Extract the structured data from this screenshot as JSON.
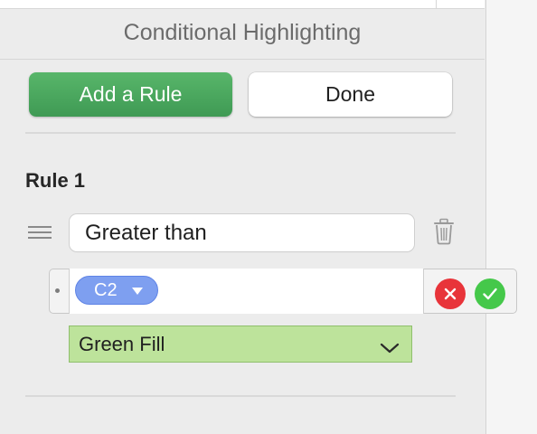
{
  "panel": {
    "title": "Conditional Highlighting"
  },
  "toolbar": {
    "add_rule_label": "Add a Rule",
    "done_label": "Done"
  },
  "rule": {
    "heading": "Rule 1",
    "condition_value": "Greater than",
    "formula_token": "C2",
    "style_value": "Green Fill"
  },
  "icons": {
    "drag_handle": "drag-handle-icon",
    "trash": "trash-icon",
    "token_menu": "triangle-down-icon",
    "cancel": "close-icon",
    "confirm": "checkmark-icon",
    "dropdown": "chevron-down-icon"
  },
  "colors": {
    "add_button": "#4aa95d",
    "token": "#7e9ff0",
    "cancel": "#e8343a",
    "confirm": "#45c84a",
    "style_fill": "#bde39b"
  }
}
